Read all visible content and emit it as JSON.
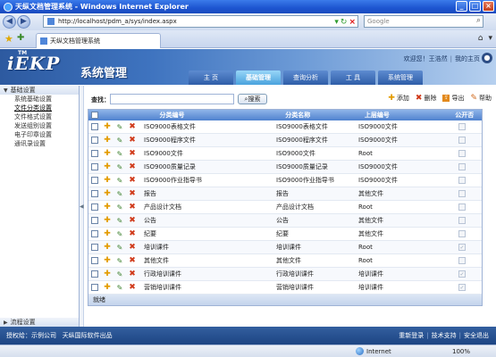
{
  "window": {
    "title": "天纵文档管理系统 - Windows Internet Explorer",
    "address": "http://localhost/pdm_a/sys/index.aspx",
    "search_placeholder": "Google",
    "tab_title": "天纵文档管理系统",
    "status_zone": "Internet",
    "status_zoom": "100%"
  },
  "app": {
    "logo": "iEKP",
    "logo_tm": "TM",
    "logo_cn": "系统管理",
    "user": {
      "welcome": "欢迎您！王浩然",
      "my_home": "我的主页"
    },
    "nav": [
      {
        "label": "主  页"
      },
      {
        "label": "基础管理"
      },
      {
        "label": "查询分析"
      },
      {
        "label": "工  具"
      },
      {
        "label": "系统管理"
      }
    ],
    "active_nav_index": 1
  },
  "sidebar": {
    "group_top": "基础设置",
    "items": [
      {
        "label": "系统基础设置"
      },
      {
        "label": "文件分类设置"
      },
      {
        "label": "文件格式设置"
      },
      {
        "label": "发送组别设置"
      },
      {
        "label": "电子印章设置"
      },
      {
        "label": "通讯录设置"
      }
    ],
    "selected_index": 1,
    "group_bottom": "流程设置"
  },
  "toolbar": {
    "search_label": "查找：",
    "search_value": "",
    "search_button": "搜索",
    "add": "添加",
    "delete": "删除",
    "export": "导出",
    "help": "帮助"
  },
  "table": {
    "headers": {
      "code": "分类编号",
      "name": "分类名称",
      "parent": "上层编号",
      "public": "公开否"
    },
    "rows": [
      {
        "code": "ISO9000表格文件",
        "name": "ISO9000表格文件",
        "parent": "ISO9000文件",
        "public": false
      },
      {
        "code": "ISO9000程序文件",
        "name": "ISO9000程序文件",
        "parent": "ISO9000文件",
        "public": false
      },
      {
        "code": "ISO9000文件",
        "name": "ISO9000文件",
        "parent": "Root",
        "public": false
      },
      {
        "code": "ISO9000质量记录",
        "name": "ISO9000质量记录",
        "parent": "ISO9000文件",
        "public": false
      },
      {
        "code": "ISO9000作业指导书",
        "name": "ISO9000作业指导书",
        "parent": "ISO9000文件",
        "public": false
      },
      {
        "code": "报告",
        "name": "报告",
        "parent": "其他文件",
        "public": false
      },
      {
        "code": "产品设计文档",
        "name": "产品设计文档",
        "parent": "Root",
        "public": false
      },
      {
        "code": "公告",
        "name": "公告",
        "parent": "其他文件",
        "public": false
      },
      {
        "code": "纪要",
        "name": "纪要",
        "parent": "其他文件",
        "public": false
      },
      {
        "code": "培训课件",
        "name": "培训课件",
        "parent": "Root",
        "public": true
      },
      {
        "code": "其他文件",
        "name": "其他文件",
        "parent": "Root",
        "public": false
      },
      {
        "code": "行政培训课件",
        "name": "行政培训课件",
        "parent": "培训课件",
        "public": true
      },
      {
        "code": "营销培训课件",
        "name": "营销培训课件",
        "parent": "培训课件",
        "public": true
      }
    ],
    "footer": "就绪"
  },
  "footer": {
    "license": "授权给：示例公司",
    "vendor": "天纵国际软件出品",
    "relogin": "重新登录",
    "support": "技术支持",
    "logout": "安全退出"
  }
}
